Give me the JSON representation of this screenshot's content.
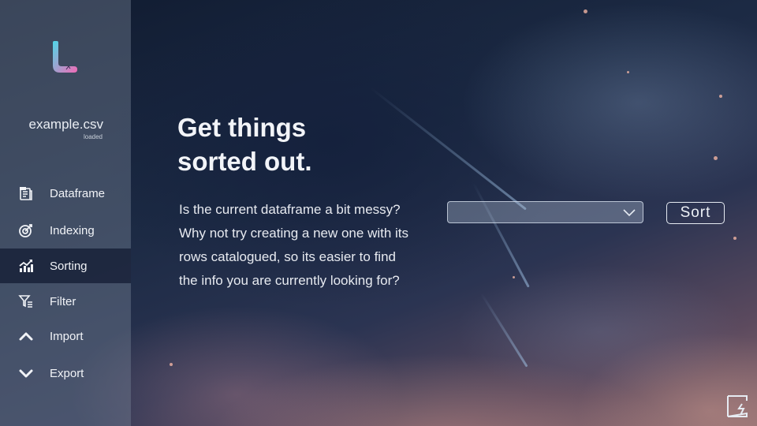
{
  "file": {
    "name": "example.csv",
    "status": "loaded"
  },
  "sidebar": {
    "items": [
      {
        "label": "Dataframe",
        "icon": "dataframe-icon",
        "active": false
      },
      {
        "label": "Indexing",
        "icon": "target-icon",
        "active": false
      },
      {
        "label": "Sorting",
        "icon": "chart-trend-icon",
        "active": true
      },
      {
        "label": "Filter",
        "icon": "filter-icon",
        "active": false
      },
      {
        "label": "Import",
        "icon": "chevron-up-icon",
        "active": false
      },
      {
        "label": "Export",
        "icon": "chevron-down-icon",
        "active": false
      }
    ]
  },
  "main": {
    "headline": "Get things sorted out.",
    "description": "Is the current dataframe a bit messy? Why not try creating a new one with its rows catalogued, so its easier to find the info you are currently looking for?",
    "dropdown": {
      "selected": ""
    },
    "sort_button": "Sort"
  },
  "colors": {
    "sidebar_bg": "#78829699",
    "active_item_bg": "#141e34",
    "logo_gradient": [
      "#4fd7e8",
      "#f26ab6"
    ]
  }
}
